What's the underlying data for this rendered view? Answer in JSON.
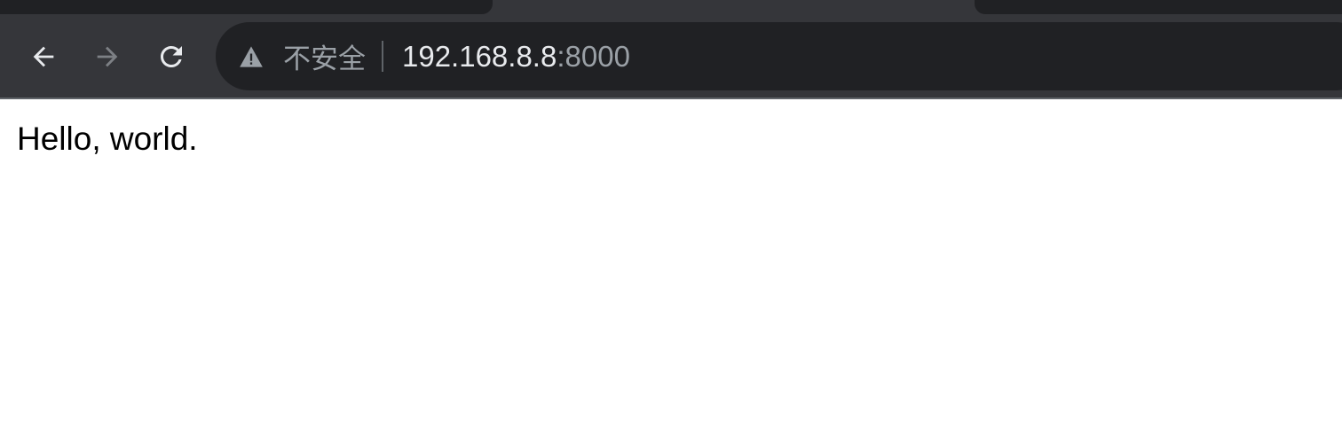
{
  "browser": {
    "toolbar_color": "#35363a",
    "omnibox_color": "#202124",
    "security": {
      "icon": "warning-triangle-icon",
      "label": "不安全",
      "color": "#9aa0a6"
    },
    "url": {
      "host": "192.168.8.8",
      "port": ":8000"
    },
    "nav": {
      "back_icon": "arrow-left-icon",
      "forward_icon": "arrow-right-icon",
      "forward_enabled": false,
      "reload_icon": "reload-icon"
    }
  },
  "page": {
    "body_text": "Hello, world.",
    "background": "#ffffff"
  }
}
